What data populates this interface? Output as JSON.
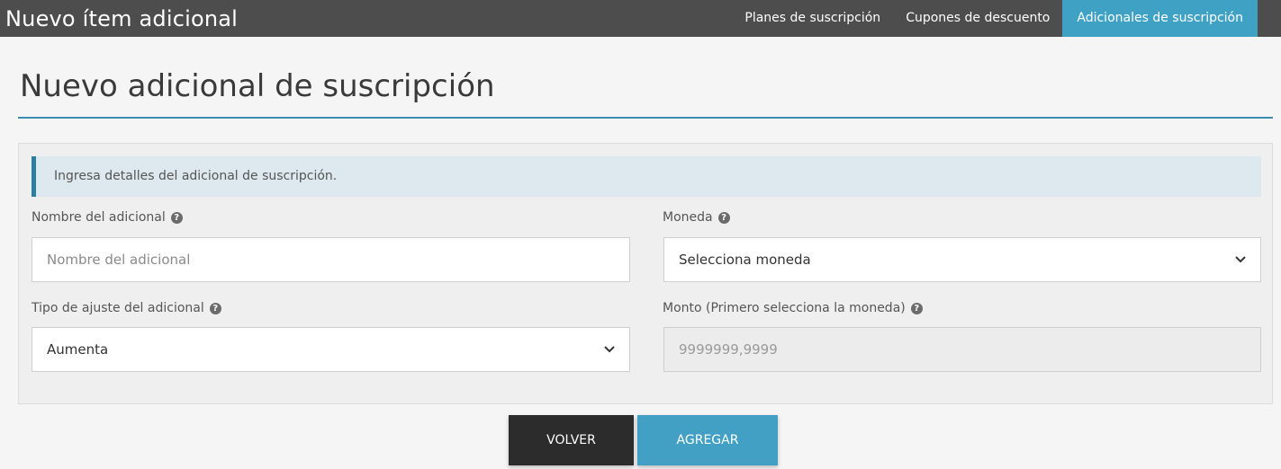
{
  "header": {
    "title": "Nuevo ítem adicional",
    "nav": [
      {
        "label": "Planes de suscripción",
        "active": false
      },
      {
        "label": "Cupones de descuento",
        "active": false
      },
      {
        "label": "Adicionales de suscripción",
        "active": true
      }
    ]
  },
  "page": {
    "title": "Nuevo adicional de suscripción"
  },
  "form": {
    "info_message": "Ingresa detalles del adicional de suscripción.",
    "name": {
      "label": "Nombre del adicional",
      "placeholder": "Nombre del adicional",
      "value": ""
    },
    "currency": {
      "label": "Moneda",
      "selected": "Selecciona moneda"
    },
    "adjustment_type": {
      "label": "Tipo de ajuste del adicional",
      "selected": "Aumenta"
    },
    "amount": {
      "label": "Monto (Primero selecciona la moneda)",
      "placeholder": "9999999,9999",
      "value": ""
    }
  },
  "actions": {
    "back_label": "VOLVER",
    "add_label": "AGREGAR"
  },
  "colors": {
    "topbar": "#4d4d4d",
    "accent": "#3fa2c4",
    "title_rule": "#3a8db0",
    "back_button": "#2c2c2c"
  },
  "icons": {
    "help": "question-circle-icon",
    "select_arrow": "chevron-down-icon"
  }
}
